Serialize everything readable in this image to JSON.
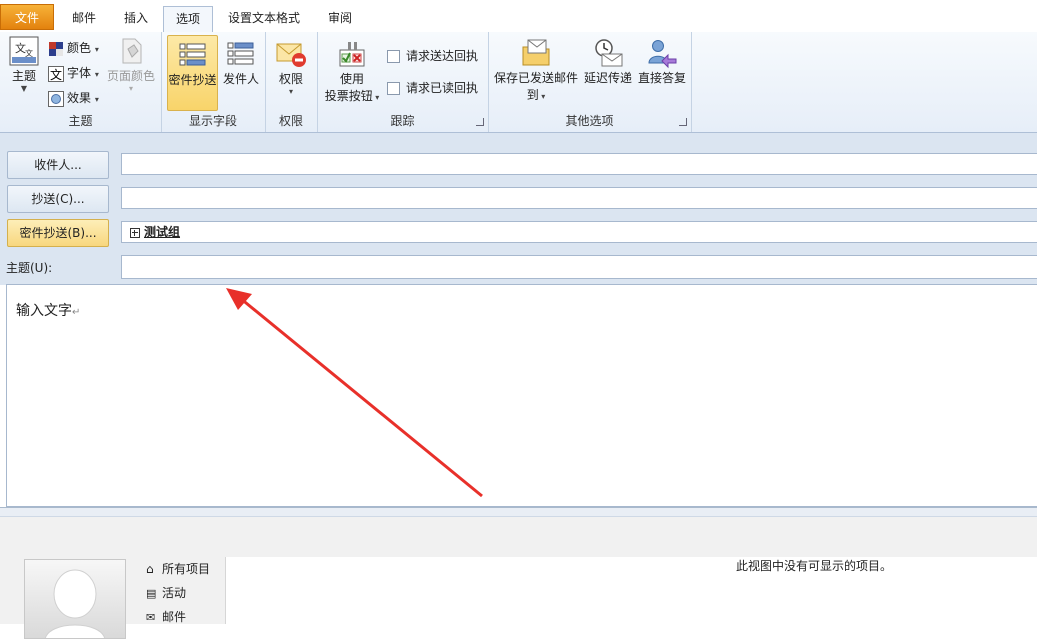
{
  "tabs": {
    "file": "文件",
    "mail": "邮件",
    "insert": "插入",
    "options": "选项",
    "format_text": "设置文本格式",
    "review": "审阅"
  },
  "ribbon": {
    "themes_group": {
      "label": "主题",
      "themes_button": "主题",
      "colors_button": "颜色",
      "fonts_button": "字体",
      "effects_button": "效果",
      "page_color_button": "页面颜色"
    },
    "show_fields_group": {
      "label": "显示字段",
      "bcc_button": "密件抄送",
      "from_button": "发件人"
    },
    "permission_group": {
      "label": "权限",
      "permission_button": "权限"
    },
    "tracking_group": {
      "label": "跟踪",
      "voting_line1": "使用",
      "voting_line2": "投票按钮",
      "delivery_receipt": "请求送达回执",
      "read_receipt": "请求已读回执"
    },
    "more_options_group": {
      "label": "其他选项",
      "save_sent_line1": "保存已发送邮件",
      "save_sent_line2": "到",
      "delay_delivery": "延迟传递",
      "direct_replies": "直接答复"
    }
  },
  "compose": {
    "to_button": "收件人...",
    "cc_button": "抄送(C)...",
    "bcc_button": "密件抄送(B)...",
    "bcc_value": "测试组",
    "subject_label": "主题(U):",
    "body_text": "输入文字"
  },
  "people_pane": {
    "nav_items": [
      "所有项目",
      "活动",
      "邮件"
    ],
    "empty_message": "此视图中没有可显示的项目。"
  },
  "colors": {
    "accent_file_tab": "#e3820e",
    "selected_button": "#f8d46a",
    "header_bg": "#dbe5f1",
    "arrow_annotation": "#e8302a"
  }
}
